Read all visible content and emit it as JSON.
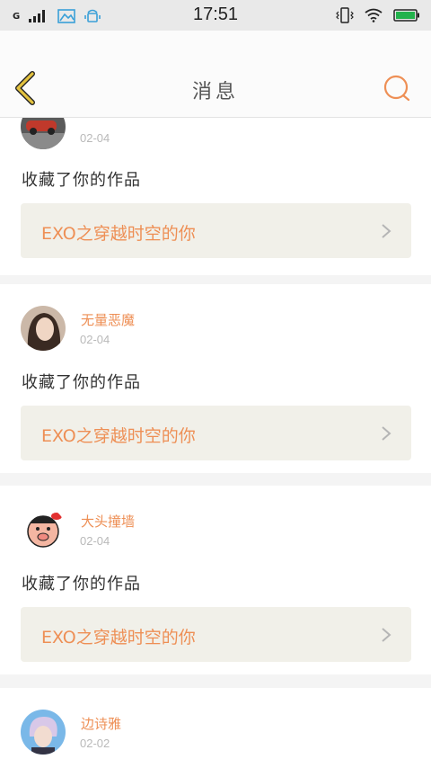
{
  "status_bar": {
    "network": "G",
    "time": "17:51"
  },
  "header": {
    "title": "消息",
    "back_icon": "chevron-left-icon",
    "search_icon": "search-icon"
  },
  "colors": {
    "accent": "#ee8f55",
    "back_arrow": "#e3c23f",
    "card_bg": "#ffffff",
    "work_bg": "#f1f0e9"
  },
  "notifications": [
    {
      "user": "",
      "date": "02-04",
      "action": "收藏了你的作品",
      "work_title": "EXO之穿越时空的你"
    },
    {
      "user": "无量恶魔",
      "date": "02-04",
      "action": "收藏了你的作品",
      "work_title": "EXO之穿越时空的你"
    },
    {
      "user": "大头撞墙",
      "date": "02-04",
      "action": "收藏了你的作品",
      "work_title": "EXO之穿越时空的你"
    },
    {
      "user": "边诗雅",
      "date": "02-02"
    }
  ]
}
